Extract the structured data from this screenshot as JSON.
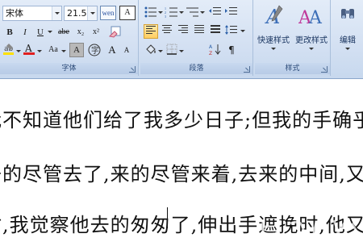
{
  "ribbon": {
    "font_group": {
      "label": "字体",
      "font_name": "宋体",
      "font_size": "21.5",
      "phonetic_icon": "wen",
      "char_border_icon": "A",
      "buttons": [
        "B",
        "I",
        "U",
        "abe",
        "x₂",
        "x²",
        "Aa",
        "A",
        "A"
      ],
      "grow_icon": "A",
      "shrink_icon": "A"
    },
    "paragraph_group": {
      "label": "段落"
    },
    "styles_group": {
      "label": "样式",
      "quick_styles_label": "快速样式",
      "change_styles_label": "更改样式"
    },
    "editing_group": {
      "label": "编辑"
    }
  },
  "document": {
    "lines": [
      "我不知道他们给了我多少日子;但我的手确乎是渐",
      "去的尽管去了,来的尽管来着,去来的中间,又怎",
      "时,我觉察他去的匆匆了,伸出手遮挽时,他又从遮挽"
    ]
  },
  "colors": {
    "ribbon_top": "#e3ecf8",
    "ribbon_bottom": "#c7d8ee",
    "group_label_text": "#2b4a78",
    "highlight_yellow": "#ffe000",
    "font_color_red": "#e02020",
    "selected_button": "#ffcf63"
  }
}
